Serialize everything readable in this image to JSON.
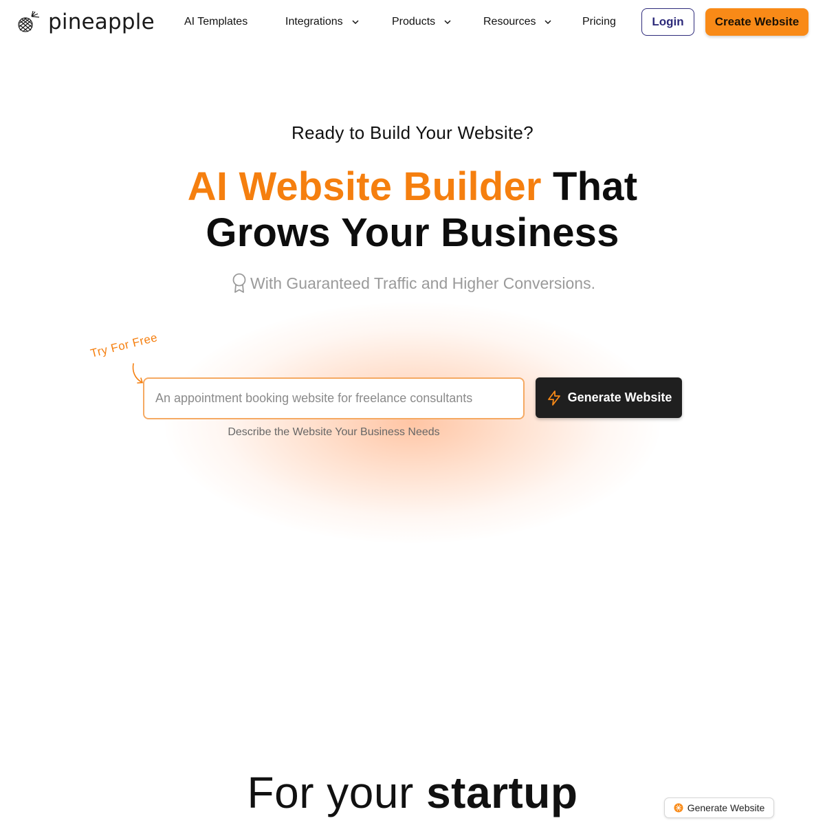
{
  "nav": {
    "logo_text": "pineapple",
    "items": [
      {
        "label": "AI Templates",
        "has_dropdown": false
      },
      {
        "label": "Integrations",
        "has_dropdown": true
      },
      {
        "label": "Products",
        "has_dropdown": true
      },
      {
        "label": "Resources",
        "has_dropdown": true
      },
      {
        "label": "Pricing",
        "has_dropdown": false
      }
    ],
    "login_label": "Login",
    "create_label": "Create Website"
  },
  "hero": {
    "eyebrow": "Ready to Build Your Website?",
    "headline_accent": "AI Website Builder",
    "headline_rest_1": "That",
    "headline_line_2": "Grows Your Business",
    "subline": "With Guaranteed Traffic and Higher Conversions.",
    "try_free": "Try For Free",
    "input_placeholder": "An appointment booking website for freelance consultants",
    "input_value": "",
    "generate_label": "Generate Website",
    "helper_text": "Describe the Website Your Business Needs"
  },
  "section": {
    "title_light": "For your",
    "title_bold": "startup"
  },
  "floating": {
    "label": "Generate Website"
  },
  "icons": {
    "logo": "pineapple-logo-icon",
    "dropdown": "chevron-down-icon",
    "award": "award-ribbon-icon",
    "arrow": "curved-arrow-icon",
    "bolt": "lightning-bolt-icon",
    "floating": "pineapple-dot-icon"
  },
  "colors": {
    "accent": "#f57f0f",
    "button_orange": "#f98a17",
    "login_border": "#2d2a7a",
    "dark_button": "#1f1f1f",
    "muted_text": "#9a9a9a"
  }
}
